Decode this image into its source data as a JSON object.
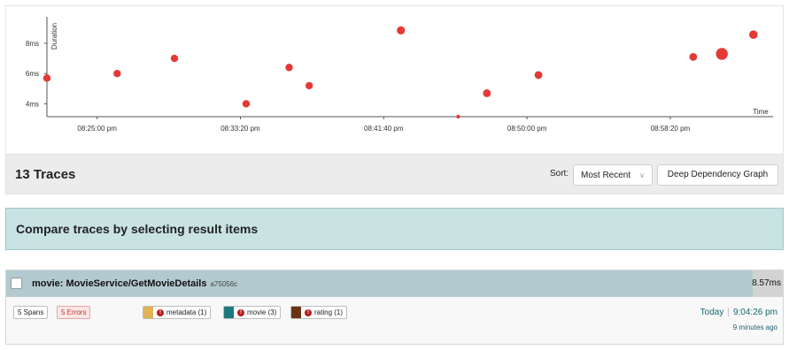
{
  "chart_data": {
    "type": "scatter",
    "ylabel": "Duration",
    "xlabel": "Time",
    "y_ticks": [
      "8ms",
      "6ms",
      "4ms"
    ],
    "y_tick_values": [
      8,
      6,
      4
    ],
    "x_ticks": [
      "08:25:00 pm",
      "08:33:20 pm",
      "08:41:40 pm",
      "08:50:00 pm",
      "08:58:20 pm"
    ],
    "x_tick_values": [
      "20:25:00",
      "20:33:20",
      "20:41:40",
      "20:50:00",
      "20:58:20"
    ],
    "xlim": [
      "20:22:05",
      "20:64:00"
    ],
    "ylim": [
      3.15,
      9.4
    ],
    "points": [
      {
        "time": "20:22:05",
        "duration": 5.7,
        "size": 1
      },
      {
        "time": "20:26:10",
        "duration": 6.0,
        "size": 1
      },
      {
        "time": "20:29:30",
        "duration": 7.0,
        "size": 1
      },
      {
        "time": "20:33:40",
        "duration": 4.0,
        "size": 1
      },
      {
        "time": "20:36:10",
        "duration": 6.4,
        "size": 1
      },
      {
        "time": "20:37:20",
        "duration": 5.2,
        "size": 1
      },
      {
        "time": "20:42:40",
        "duration": 8.85,
        "size": 1.1
      },
      {
        "time": "20:46:00",
        "duration": 3.15,
        "size": 0.5
      },
      {
        "time": "20:47:40",
        "duration": 4.7,
        "size": 1.05
      },
      {
        "time": "20:50:40",
        "duration": 5.9,
        "size": 1.05
      },
      {
        "time": "20:59:40",
        "duration": 7.1,
        "size": 1.05
      },
      {
        "time": "21:01:20",
        "duration": 7.3,
        "size": 1.6
      },
      {
        "time": "21:03:10",
        "duration": 8.57,
        "size": 1.15
      }
    ],
    "point_color": "#e53935"
  },
  "summary": {
    "trace_count": "13 Traces",
    "sort_label": "Sort:",
    "sort_value": "Most Recent",
    "ddg_button": "Deep Dependency Graph"
  },
  "compare": {
    "text": "Compare traces by selecting result items"
  },
  "trace": {
    "title": "movie: MovieService/GetMovieDetails",
    "trace_id": "a75056c",
    "duration": "8.57ms",
    "spans": "5 Spans",
    "errors": "5 Errors",
    "services": [
      {
        "label": "metadata (1)",
        "color": "#e0b356"
      },
      {
        "label": "movie (3)",
        "color": "#1d7a7d"
      },
      {
        "label": "rating (1)",
        "color": "#6b3314"
      }
    ],
    "date": "Today",
    "time": "9:04:26 pm",
    "ago": "9 minutes ago"
  },
  "colors": {
    "accent": "#1a6673",
    "error": "#b71c1c"
  }
}
